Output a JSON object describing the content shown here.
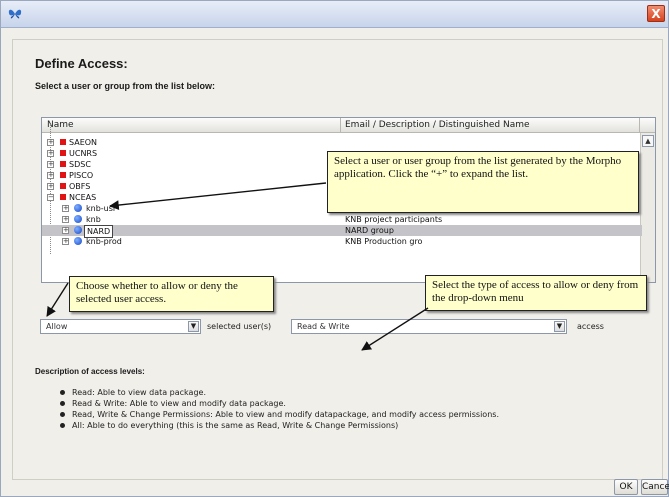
{
  "window": {
    "close_glyph": "X",
    "app_icon": "morpho-butterfly-icon"
  },
  "header": {
    "title": "Define Access:",
    "subtitle": "Select a user or group from the list below:"
  },
  "list": {
    "columns": [
      "Name",
      "Email / Description / Distinguished Name"
    ],
    "rows": [
      {
        "label": "SAEON",
        "desc": ""
      },
      {
        "label": "UCNRS",
        "desc": ""
      },
      {
        "label": "SDSC",
        "desc": ""
      },
      {
        "label": "PISCO",
        "desc": ""
      },
      {
        "label": "OBFS",
        "desc": ""
      },
      {
        "label": "NCEAS",
        "desc": ""
      },
      {
        "label": "knb-usr",
        "desc": ""
      },
      {
        "label": "knb",
        "desc": "KNB project participants"
      },
      {
        "label": "NARD",
        "desc": "NARD group"
      },
      {
        "label": "knb-prod",
        "desc": "KNB Production gro"
      }
    ]
  },
  "controls": {
    "permission_select": "Allow",
    "users_label": "selected user(s)",
    "access_select": "Read & Write",
    "access_label": "access"
  },
  "description": {
    "title": "Description of access levels:",
    "items": [
      "Read: Able to view data package.",
      "Read & Write: Able to view and modify data package.",
      "Read, Write & Change Permissions: Able to view and modify datapackage, and modify access permissions.",
      "All: Able to do everything (this is the same as Read, Write & Change Permissions)"
    ]
  },
  "callouts": {
    "tree": "Select a user or user group from the list generated by the Morpho application. Click the “+” to expand the list.",
    "allow": "Choose whether to allow or deny the selected user access.",
    "access": "Select the type of access to allow or deny from the drop-down menu"
  },
  "buttons": {
    "ok": "OK",
    "cancel": "Cancel"
  }
}
